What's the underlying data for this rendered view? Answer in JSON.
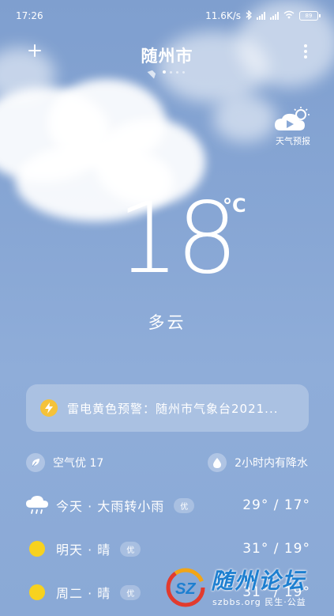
{
  "status_bar": {
    "time": "17:26",
    "network_speed": "11.6K/s",
    "battery_level": "89",
    "icons": [
      "bluetooth-icon",
      "signal-icon",
      "signal-icon",
      "wifi-icon",
      "battery-icon"
    ]
  },
  "header": {
    "city": "随州市",
    "page_count": 5,
    "active_page": 2
  },
  "forecast_video": {
    "label": "天气预报",
    "icon": "weather-video-icon"
  },
  "current": {
    "temperature": "18",
    "unit": "°C",
    "condition": "多云"
  },
  "alert": {
    "text": "雷电黄色预警：随州市气象台2021...",
    "icon": "lightning-icon",
    "icon_color": "#f5c23a"
  },
  "info": {
    "air_quality": "空气优 17",
    "precipitation": "2小时内有降水",
    "air_icon": "leaf-icon",
    "rain_icon": "water-drop-icon"
  },
  "daily": [
    {
      "label": "今天 · 大雨转小雨",
      "aqi": "优",
      "temps": "29° / 17°",
      "icon": "rain-cloud-icon"
    },
    {
      "label": "明天 · 晴",
      "aqi": "优",
      "temps": "31° / 19°",
      "icon": "sun-icon"
    },
    {
      "label": "周二 · 晴",
      "aqi": "优",
      "temps": "31° / 19°",
      "icon": "sun-icon"
    }
  ],
  "watermark": {
    "title": "随州论坛",
    "subtitle": "szbbs.org 民生·公益"
  }
}
